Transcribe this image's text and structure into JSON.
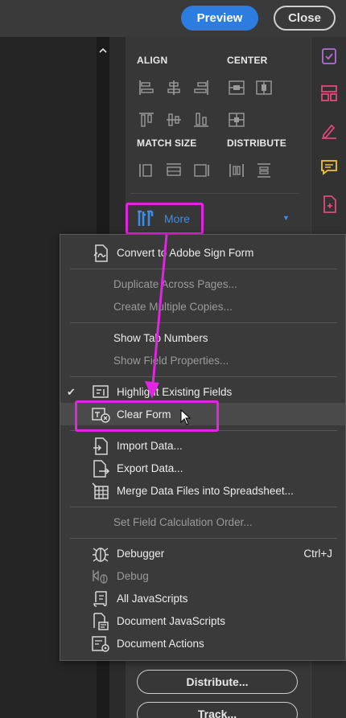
{
  "topbar": {
    "preview_label": "Preview",
    "close_label": "Close"
  },
  "panel": {
    "align_label": "ALIGN",
    "center_label": "CENTER",
    "match_size_label": "MATCH SIZE",
    "distribute_label": "DISTRIBUTE",
    "more_label": "More",
    "distribute_button": "Distribute...",
    "track_button": "Track..."
  },
  "menu": {
    "items": [
      {
        "label": "Convert to Adobe Sign Form",
        "icon": "convert-sign-icon",
        "enabled": true
      },
      {
        "label": "Duplicate Across Pages...",
        "enabled": false
      },
      {
        "label": "Create Multiple Copies...",
        "enabled": false
      },
      {
        "label": "Show Tab Numbers",
        "enabled": true
      },
      {
        "label": "Show Field Properties...",
        "enabled": false
      },
      {
        "label": "Highlight Existing Fields",
        "icon": "highlight-fields-icon",
        "enabled": true,
        "checked": true
      },
      {
        "label": "Clear Form",
        "icon": "clear-form-icon",
        "enabled": true,
        "hovered": true
      },
      {
        "label": "Import Data...",
        "icon": "import-data-icon",
        "enabled": true
      },
      {
        "label": "Export Data...",
        "icon": "export-data-icon",
        "enabled": true
      },
      {
        "label": "Merge Data Files into Spreadsheet...",
        "icon": "merge-spreadsheet-icon",
        "enabled": true
      },
      {
        "label": "Set Field Calculation Order...",
        "enabled": false
      },
      {
        "label": "Debugger",
        "icon": "debugger-icon",
        "enabled": true,
        "shortcut": "Ctrl+J"
      },
      {
        "label": "Debug",
        "icon": "debug-icon",
        "enabled": false
      },
      {
        "label": "All JavaScripts",
        "icon": "all-javascripts-icon",
        "enabled": true
      },
      {
        "label": "Document JavaScripts",
        "icon": "document-javascripts-icon",
        "enabled": true
      },
      {
        "label": "Document Actions",
        "icon": "document-actions-icon",
        "enabled": true
      }
    ]
  },
  "colors": {
    "accent": "#2d7de0",
    "highlight": "#e026e0",
    "link": "#3b8ee8"
  }
}
